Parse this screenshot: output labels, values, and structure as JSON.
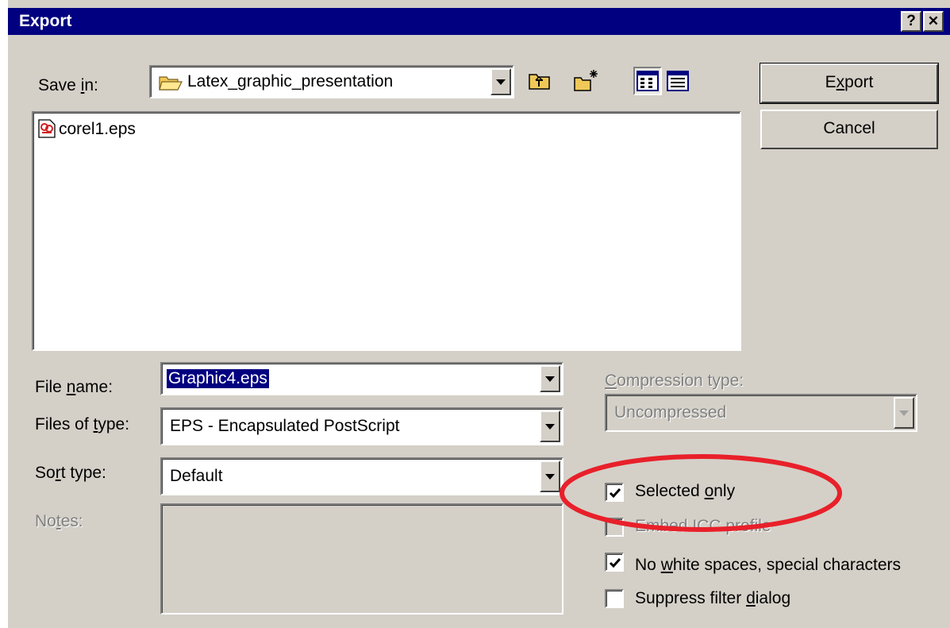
{
  "window": {
    "title": "Export",
    "help_glyph": "?",
    "close_glyph": "✕"
  },
  "save_in": {
    "label": "Save in:",
    "folder": "Latex_graphic_presentation"
  },
  "file_list": [
    {
      "name": "corel1.eps",
      "icon": "eps-file-icon"
    }
  ],
  "buttons": {
    "export": "Export",
    "cancel": "Cancel"
  },
  "file_name": {
    "label": "File name:",
    "value": "Graphic4.eps"
  },
  "files_of_type": {
    "label": "Files of type:",
    "value": "EPS - Encapsulated PostScript"
  },
  "sort_type": {
    "label": "Sort type:",
    "value": "Default"
  },
  "notes": {
    "label": "Notes:"
  },
  "compression": {
    "label": "Compression type:",
    "value": "Uncompressed"
  },
  "options": {
    "selected_only": {
      "label": "Selected only",
      "checked": true
    },
    "embed_icc": {
      "label": "Embed ICC profile",
      "checked": false,
      "disabled": true
    },
    "no_white_spaces": {
      "label": "No white spaces, special characters",
      "checked": true
    },
    "suppress_filter": {
      "label": "Suppress filter dialog",
      "checked": false
    }
  },
  "colors": {
    "titlebar": "#000080",
    "face": "#d4d0c8",
    "selection": "#000080",
    "annotation": "#e8202a"
  }
}
